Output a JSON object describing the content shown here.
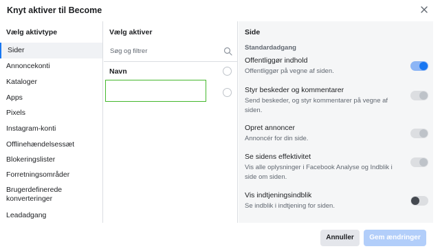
{
  "dialog": {
    "title": "Knyt aktiver til Become"
  },
  "asset_types": {
    "heading": "Vælg aktivtype",
    "items": [
      {
        "label": "Sider",
        "selected": true
      },
      {
        "label": "Annoncekonti",
        "selected": false
      },
      {
        "label": "Kataloger",
        "selected": false
      },
      {
        "label": "Apps",
        "selected": false
      },
      {
        "label": "Pixels",
        "selected": false
      },
      {
        "label": "Instagram-konti",
        "selected": false
      },
      {
        "label": "Offlinehændelsessæt",
        "selected": false
      },
      {
        "label": "Blokeringslister",
        "selected": false
      },
      {
        "label": "Forretningsområder",
        "selected": false
      },
      {
        "label": "Brugerdefinerede konverteringer",
        "selected": false
      },
      {
        "label": "Leadadgang",
        "selected": false
      }
    ]
  },
  "assets": {
    "heading": "Vælg aktiver",
    "search_placeholder": "Søg og filtrer",
    "name_column": "Navn"
  },
  "permissions": {
    "heading": "Side",
    "section": "Standardadgang",
    "items": [
      {
        "title": "Offentliggør indhold",
        "desc": "Offentliggør på vegne af siden.",
        "state": "on"
      },
      {
        "title": "Styr beskeder og kommentarer",
        "desc": "Send beskeder, og styr kommentarer på vegne af siden.",
        "state": "disabled"
      },
      {
        "title": "Opret annoncer",
        "desc": "Annoncér for din side.",
        "state": "disabled"
      },
      {
        "title": "Se sidens effektivitet",
        "desc": "Vis alle oplysninger i Facebook Analyse og Indblik i side om siden.",
        "state": "disabled"
      },
      {
        "title": "Vis indtjeningsindblik",
        "desc": "Se indblik i indtjening for siden.",
        "state": "off"
      }
    ]
  },
  "footer": {
    "cancel_label": "Annuller",
    "save_label": "Gem ændringer"
  }
}
